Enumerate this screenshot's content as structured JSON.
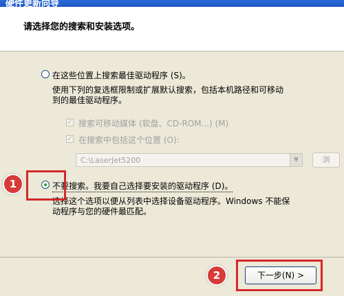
{
  "window": {
    "title": "硬件更新向导"
  },
  "header": {
    "instruction": "请选择您的搜索和安装选项。"
  },
  "options": {
    "search": {
      "label": "在这些位置上搜索最佳驱动程序 (S)。",
      "description_line1": "使用下列的复选框限制或扩展默认搜索，包括本机路径和可移动",
      "description_line2": "到的最佳驱动程序。",
      "checkbox_removable": "搜索可移动媒体 (软盘、CD-ROM...) (M)",
      "checkbox_location": "在搜索中包括这个位置 (O):",
      "path_value": "C:\\LaserJet5200",
      "browse_label": "浏",
      "selected": false
    },
    "nosearch": {
      "label": "不要搜索。我要自己选择要安装的驱动程序 (D)。",
      "description_line1": "选择这个选项以便从列表中选择设备驱动程序。Windows 不能保",
      "description_line2": "动程序与您的硬件最匹配。",
      "selected": true
    }
  },
  "footer": {
    "next_label": "下一步(N) >"
  },
  "annotations": {
    "step1": "1",
    "step2": "2"
  },
  "colors": {
    "highlight": "#d2282c",
    "badge": "#d83a3a"
  }
}
